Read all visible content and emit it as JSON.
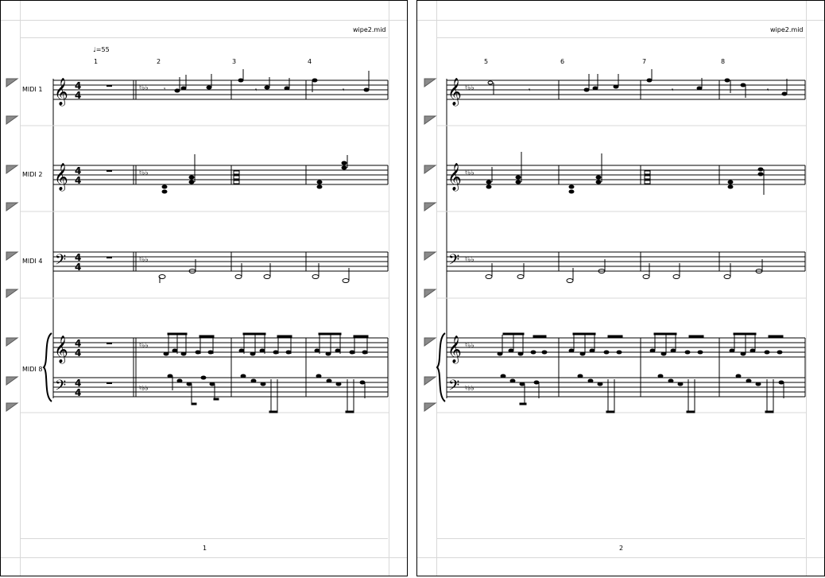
{
  "score": {
    "file_name": "wipe2.mid",
    "tempo": "♩=55",
    "instruments": [
      "MIDI 1",
      "MIDI 2",
      "MIDI 4",
      "MIDI 8"
    ],
    "time_signature": {
      "numerator": "4",
      "denominator": "4"
    }
  },
  "pages": [
    {
      "page_number": "1",
      "measure_numbers": [
        "1",
        "2",
        "3",
        "4"
      ]
    },
    {
      "page_number": "2",
      "measure_numbers": [
        "5",
        "6",
        "7",
        "8"
      ]
    }
  ],
  "icons": {
    "staff_handle": "triangle-handle-icon",
    "treble_clef": "treble-clef-icon",
    "bass_clef": "bass-clef-icon",
    "brace": "brace-icon"
  },
  "colors": {
    "page_border": "#000000",
    "guide_lines": "#d8d8d8",
    "handle_fill": "#8a8a8a",
    "ink": "#000000"
  }
}
